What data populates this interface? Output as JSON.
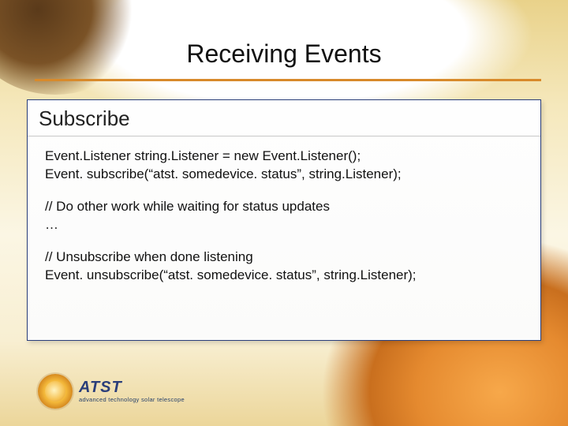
{
  "title": "Receiving Events",
  "panel": {
    "header": "Subscribe",
    "code": {
      "l1": "Event.Listener string.Listener = new Event.Listener();",
      "l2": "Event. subscribe(“atst. somedevice. status”, string.Listener);",
      "l3": "// Do other work while waiting for status updates",
      "l4": "…",
      "l5": "// Unsubscribe when done listening",
      "l6": "Event. unsubscribe(“atst. somedevice. status”, string.Listener);"
    }
  },
  "logo": {
    "acronym": "ATST",
    "subtitle": "advanced technology solar telescope"
  }
}
